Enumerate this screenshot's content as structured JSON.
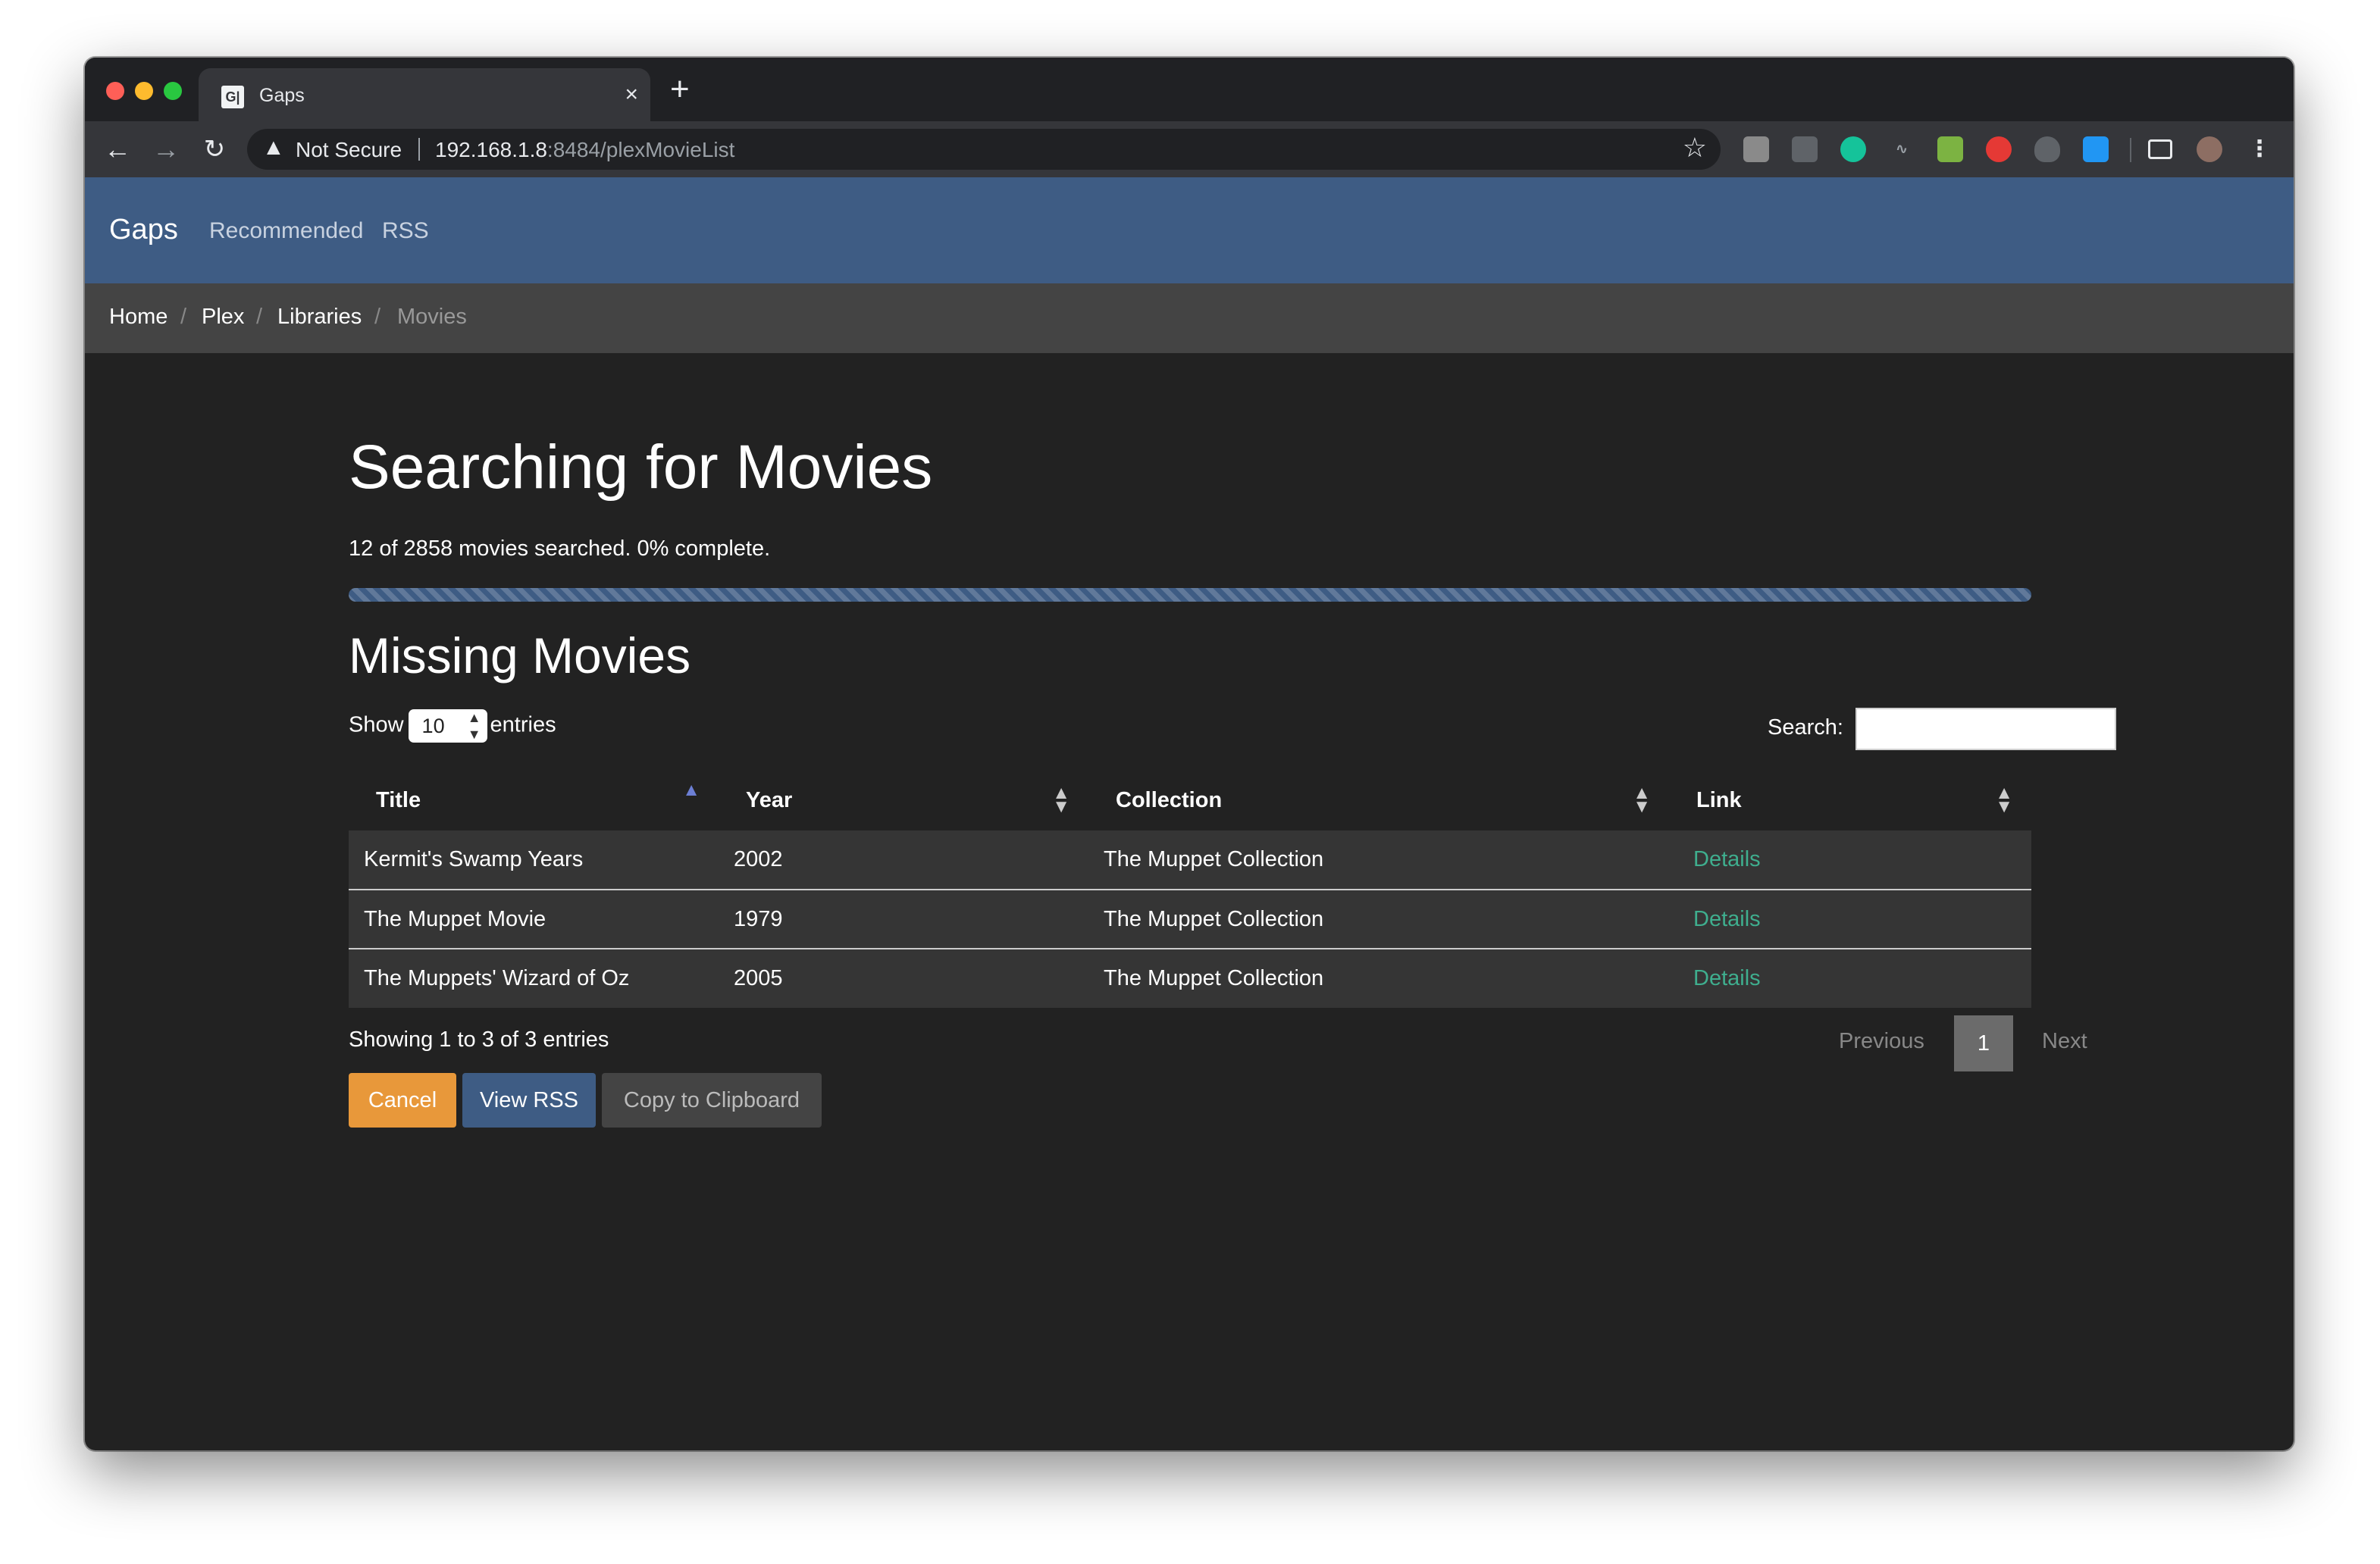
{
  "browser": {
    "tab_title": "Gaps",
    "tab_favicon": "G|",
    "close_glyph": "×",
    "new_tab_glyph": "+",
    "security_text": "Not Secure",
    "url_host": "192.168.1.8",
    "url_path": ":8484/plexMovieList"
  },
  "navbar": {
    "brand": "Gaps",
    "links": [
      "Recommended",
      "RSS"
    ]
  },
  "breadcrumb": [
    "Home",
    "Plex",
    "Libraries",
    "Movies"
  ],
  "main": {
    "title": "Searching for Movies",
    "progress_text": "12 of 2858 movies searched. 0% complete.",
    "progress_value": 0,
    "section_title": "Missing Movies",
    "show_label": "Show",
    "entries_label": "entries",
    "page_length": "10",
    "search_label": "Search:",
    "search_value": ""
  },
  "table": {
    "columns": [
      "Title",
      "Year",
      "Collection",
      "Link"
    ],
    "rows": [
      {
        "title": "Kermit's Swamp Years",
        "year": "2002",
        "collection": "The Muppet Collection",
        "link": "Details"
      },
      {
        "title": "The Muppet Movie",
        "year": "1979",
        "collection": "The Muppet Collection",
        "link": "Details"
      },
      {
        "title": "The Muppets' Wizard of Oz",
        "year": "2005",
        "collection": "The Muppet Collection",
        "link": "Details"
      }
    ]
  },
  "info": "Showing 1 to 3 of 3 entries",
  "pagination": {
    "previous": "Previous",
    "page": "1",
    "next": "Next"
  },
  "buttons": {
    "cancel": "Cancel",
    "view_rss": "View RSS",
    "copy": "Copy to Clipboard"
  },
  "colors": {
    "navbar": "#3e5c84",
    "breadcrumb_bg": "#444444",
    "page_bg": "#222222",
    "cancel": "#e8983a",
    "link": "#3fae8e"
  }
}
